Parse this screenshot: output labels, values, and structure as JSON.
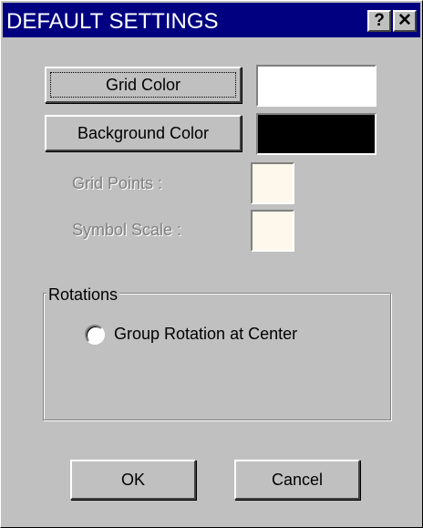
{
  "window": {
    "title": "DEFAULT SETTINGS",
    "help_label": "?",
    "close_label": "✕"
  },
  "colors": {
    "grid_color": "#ffffff",
    "background_color": "#000000",
    "field_background": "#fdf7ec"
  },
  "buttons": {
    "grid_color_label": "Grid Color",
    "background_color_label": "Background Color",
    "ok_label": "OK",
    "cancel_label": "Cancel"
  },
  "fields": {
    "grid_points_label": "Grid Points :",
    "grid_points_value": "",
    "symbol_scale_label": "Symbol Scale :",
    "symbol_scale_value": ""
  },
  "rotations": {
    "group_label": "Rotations",
    "options": [
      {
        "label": "Group Rotation at Center",
        "selected": false
      }
    ]
  }
}
